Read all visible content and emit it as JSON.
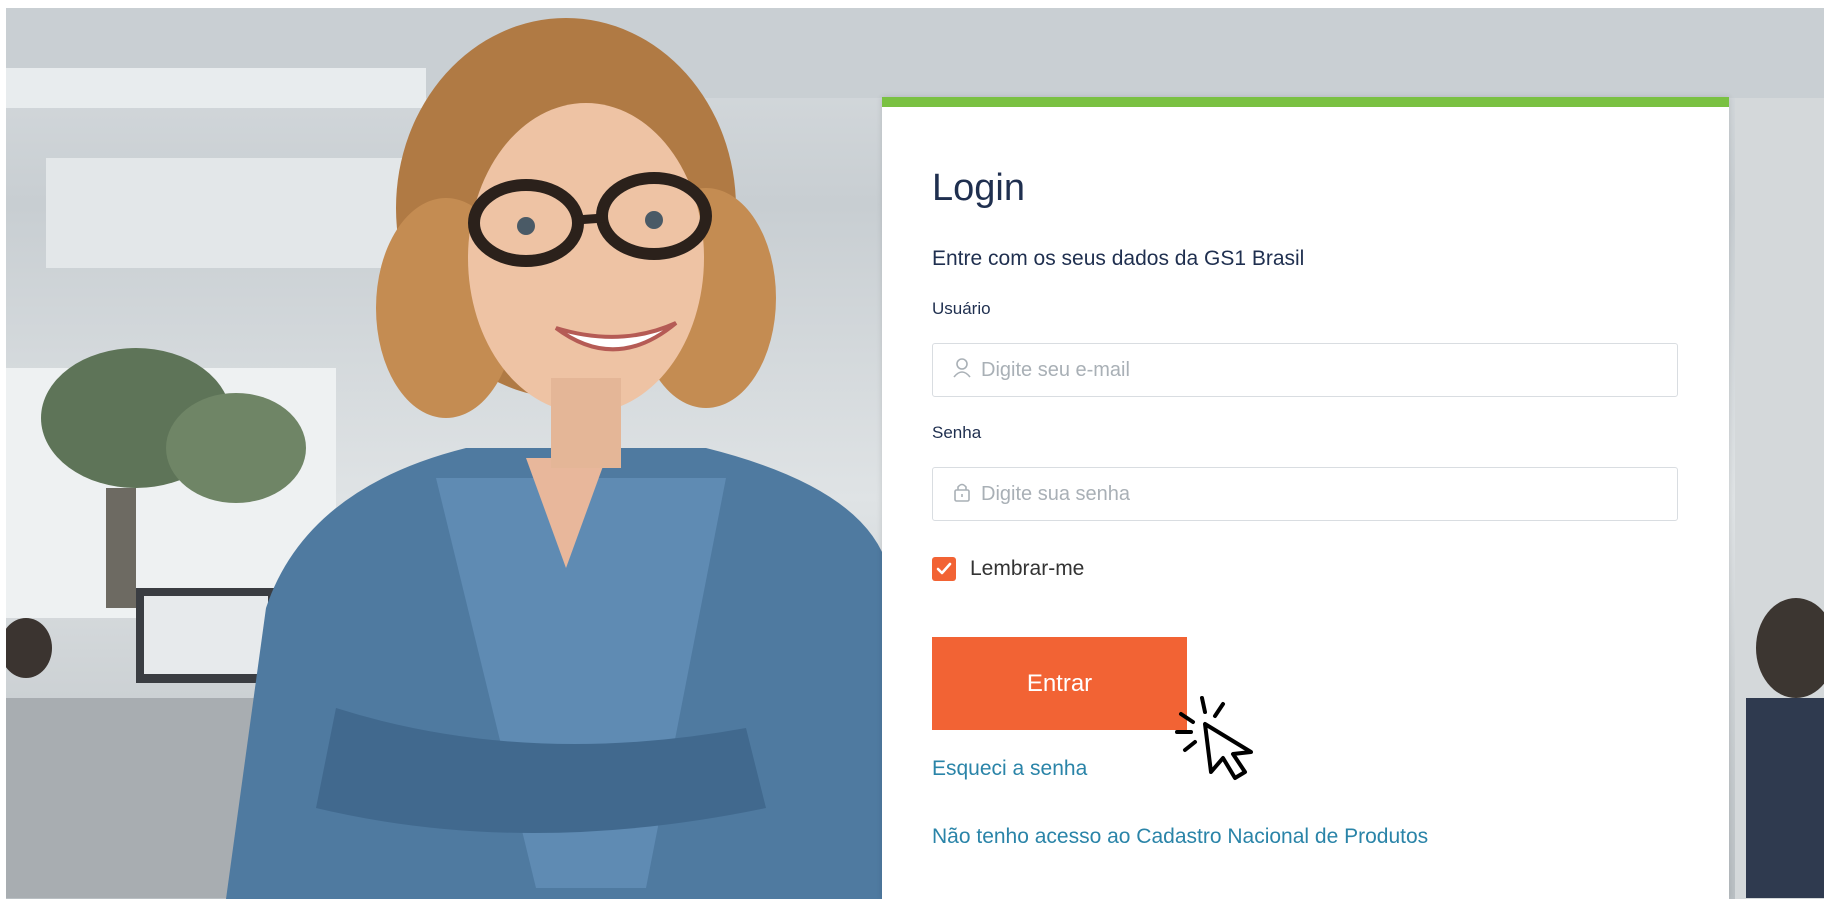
{
  "login": {
    "title": "Login",
    "subtitle": "Entre com os seus dados da GS1 Brasil",
    "username_label": "Usuário",
    "username_placeholder": "Digite seu e-mail",
    "password_label": "Senha",
    "password_placeholder": "Digite sua senha",
    "remember_label": "Lembrar-me",
    "remember_checked": true,
    "submit_label": "Entrar",
    "forgot_link": "Esqueci a senha",
    "no_access_link": "Não tenho acesso ao Cadastro Nacional de Produtos"
  },
  "icons": {
    "user": "user-icon",
    "lock": "lock-icon",
    "check": "check-icon",
    "cursor": "click-cursor-icon"
  },
  "colors": {
    "accent_orange": "#f26334",
    "top_bar_green": "#7ac142",
    "heading_navy": "#1f2f4f",
    "link_blue": "#2a84a8"
  }
}
